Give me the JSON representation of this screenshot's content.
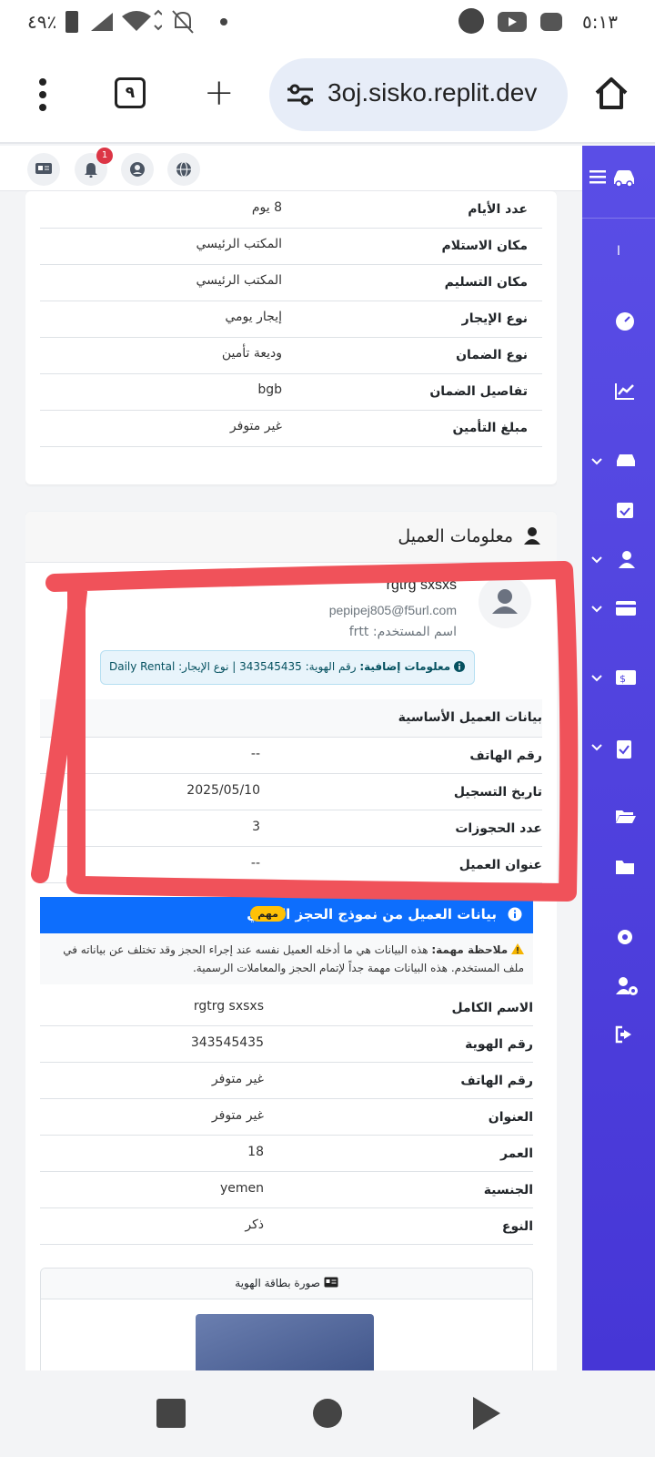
{
  "status_bar": {
    "time": "٥:١٣",
    "battery": "٤٩٪"
  },
  "browser": {
    "tab_count": "٩",
    "url": "3oj.sisko.replit.dev"
  },
  "app_bar": {
    "notification_count": "1"
  },
  "sidebar": {
    "separator_label": "ا"
  },
  "booking_details": {
    "rows": [
      {
        "label": "عدد الأيام",
        "value": "8 يوم"
      },
      {
        "label": "مكان الاستلام",
        "value": "المكتب الرئيسي"
      },
      {
        "label": "مكان التسليم",
        "value": "المكتب الرئيسي"
      },
      {
        "label": "نوع الإيجار",
        "value": "إيجار يومي"
      },
      {
        "label": "نوع الضمان",
        "value": "وديعة تأمين"
      },
      {
        "label": "تفاصيل الضمان",
        "value": "bgb"
      },
      {
        "label": "مبلغ التأمين",
        "value": "غير متوفر"
      }
    ]
  },
  "customer": {
    "section_title": "معلومات العميل",
    "name": "rgtrg sxsxs",
    "email": "pepipej805@f5url.com",
    "username_line": "اسم المستخدم: frtt",
    "extra_info_label": "معلومات إضافية:",
    "extra_info_value": "رقم الهوية: 343545435 | نوع الإيجار: Daily Rental",
    "basic_title": "بيانات العميل الأساسية",
    "basic_rows": [
      {
        "label": "رقم الهاتف",
        "value": "--"
      },
      {
        "label": "تاريخ التسجيل",
        "value": "2025/05/10"
      },
      {
        "label": "عدد الحجوزات",
        "value": "3"
      },
      {
        "label": "عنوان العميل",
        "value": "--"
      }
    ],
    "form_title": "بيانات العميل من نموذج الحجز الحالي",
    "form_badge": "مهم",
    "note_label": "ملاحظة مهمة:",
    "note_text": "هذه البيانات هي ما أدخله العميل نفسه عند إجراء الحجز وقد تختلف عن بياناته في ملف المستخدم. هذه البيانات مهمة جداً لإتمام الحجز والمعاملات الرسمية.",
    "form_rows": [
      {
        "label": "الاسم الكامل",
        "value": "rgtrg sxsxs"
      },
      {
        "label": "رقم الهوية",
        "value": "343545435"
      },
      {
        "label": "رقم الهاتف",
        "value": "غير متوفر"
      },
      {
        "label": "العنوان",
        "value": "غير متوفر"
      },
      {
        "label": "العمر",
        "value": "18"
      },
      {
        "label": "الجنسية",
        "value": "yemen"
      },
      {
        "label": "النوع",
        "value": "ذكر"
      }
    ],
    "id_card_title": "صورة بطاقة الهوية"
  },
  "colors": {
    "sidebar": "#4f42e0",
    "primary_blue": "#0d6efd",
    "warning": "#ffc107",
    "annotation_red": "#f0525a"
  }
}
